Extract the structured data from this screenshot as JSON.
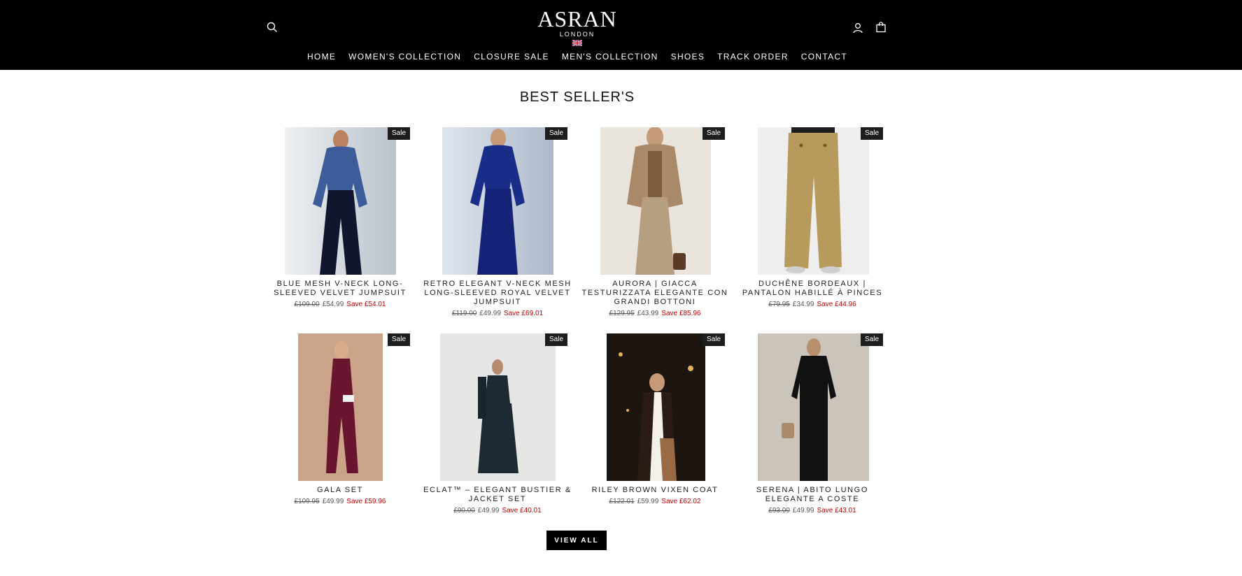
{
  "header": {
    "logo_text": "ASRAN",
    "logo_sub": "LONDON",
    "nav": [
      {
        "label": "HOME"
      },
      {
        "label": "WOMEN'S COLLECTION"
      },
      {
        "label": "CLOSURE SALE"
      },
      {
        "label": "MEN'S COLLECTION"
      },
      {
        "label": "SHOES"
      },
      {
        "label": "TRACK ORDER"
      },
      {
        "label": "CONTACT"
      }
    ]
  },
  "section": {
    "title": "BEST SELLER'S",
    "view_all_label": "VIEW ALL"
  },
  "products": [
    {
      "badge": "Sale",
      "name": "Blue Mesh V-Neck Long-Sleeved Velvet Jumpsuit",
      "was": "£109.00",
      "now": "£54.99",
      "save": "Save £54.01"
    },
    {
      "badge": "Sale",
      "name": "Retro Elegant V-Neck Mesh Long-Sleeved Royal Velvet Jumpsuit",
      "was": "£119.00",
      "now": "£49.99",
      "save": "Save £69.01"
    },
    {
      "badge": "Sale",
      "name": "Aurora | Giacca Testurizzata Elegante con Grandi Bottoni",
      "was": "£129.95",
      "now": "£43.99",
      "save": "Save £85.96"
    },
    {
      "badge": "Sale",
      "name": "Duchêne Bordeaux | Pantalon Habillé à Pinces",
      "was": "£79.95",
      "now": "£34.99",
      "save": "Save £44.96"
    },
    {
      "badge": "Sale",
      "name": "Gala Set",
      "was": "£109.95",
      "now": "£49.99",
      "save": "Save £59.96"
    },
    {
      "badge": "Sale",
      "name": "Eclat™ – Elegant Bustier & Jacket Set",
      "was": "£90.00",
      "now": "£49.99",
      "save": "Save £40.01"
    },
    {
      "badge": "Sale",
      "name": "Riley Brown Vixen Coat",
      "was": "£122.01",
      "now": "£59.99",
      "save": "Save £62.02"
    },
    {
      "badge": "Sale",
      "name": "Serena | Abito Lungo Elegante a Coste",
      "was": "£93.00",
      "now": "£49.99",
      "save": "Save £43.01"
    }
  ]
}
